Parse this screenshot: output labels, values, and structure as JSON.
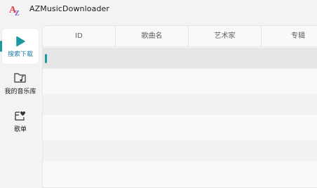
{
  "window": {
    "title": "AZMusicDownloader"
  },
  "sidebar": {
    "items": [
      {
        "label": "搜索下载",
        "icon": "play-icon",
        "active": true
      },
      {
        "label": "我的音乐库",
        "icon": "music-folder-icon",
        "active": false
      },
      {
        "label": "歌单",
        "icon": "heart-list-icon",
        "active": false
      }
    ]
  },
  "table": {
    "columns": [
      "ID",
      "歌曲名",
      "艺术家",
      "专辑"
    ],
    "rows": []
  },
  "colors": {
    "accent": "#1a9aa0",
    "active_label": "#1f7fa8"
  }
}
